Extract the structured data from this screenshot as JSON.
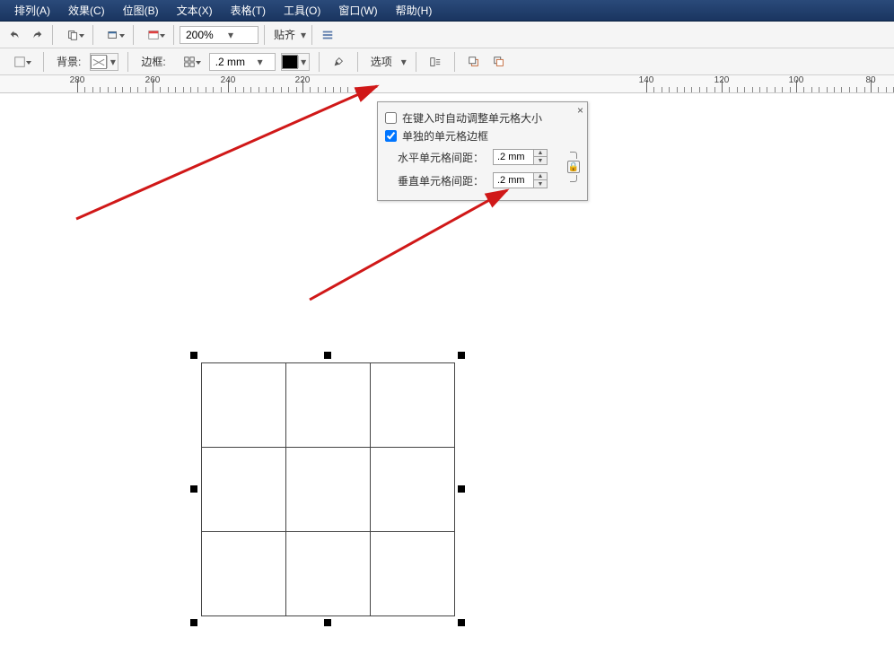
{
  "menubar": {
    "items": [
      {
        "label": "排列(A)"
      },
      {
        "label": "效果(C)"
      },
      {
        "label": "位图(B)"
      },
      {
        "label": "文本(X)"
      },
      {
        "label": "表格(T)"
      },
      {
        "label": "工具(O)"
      },
      {
        "label": "窗口(W)"
      },
      {
        "label": "帮助(H)"
      }
    ]
  },
  "toolbar1": {
    "zoom_value": "200%",
    "snap_label": "贴齐"
  },
  "toolbar2": {
    "background_label": "背景:",
    "border_label": "边框:",
    "border_width": ".2 mm",
    "options_label": "选项"
  },
  "ruler": {
    "ticks": [
      {
        "pos": 86,
        "label": "280"
      },
      {
        "pos": 170,
        "label": "260"
      },
      {
        "pos": 254,
        "label": "240"
      },
      {
        "pos": 337,
        "label": "220"
      },
      {
        "pos": 720,
        "label": "140"
      },
      {
        "pos": 804,
        "label": "120"
      },
      {
        "pos": 887,
        "label": "100"
      },
      {
        "pos": 970,
        "label": "80"
      }
    ]
  },
  "popup": {
    "close": "×",
    "auto_resize_label": "在键入时自动调整单元格大小",
    "auto_resize_checked": false,
    "separate_borders_label": "单独的单元格边框",
    "separate_borders_checked": true,
    "h_spacing_label": "水平单元格间距：",
    "h_spacing_value": ".2 mm",
    "v_spacing_label": "垂直单元格间距：",
    "v_spacing_value": ".2 mm"
  },
  "table": {
    "rows": 3,
    "cols": 3
  },
  "chart_data": {
    "type": "table",
    "title": "",
    "rows": 3,
    "cols": 3,
    "cells": [
      [
        "",
        "",
        ""
      ],
      [
        "",
        "",
        ""
      ],
      [
        "",
        "",
        ""
      ]
    ]
  }
}
